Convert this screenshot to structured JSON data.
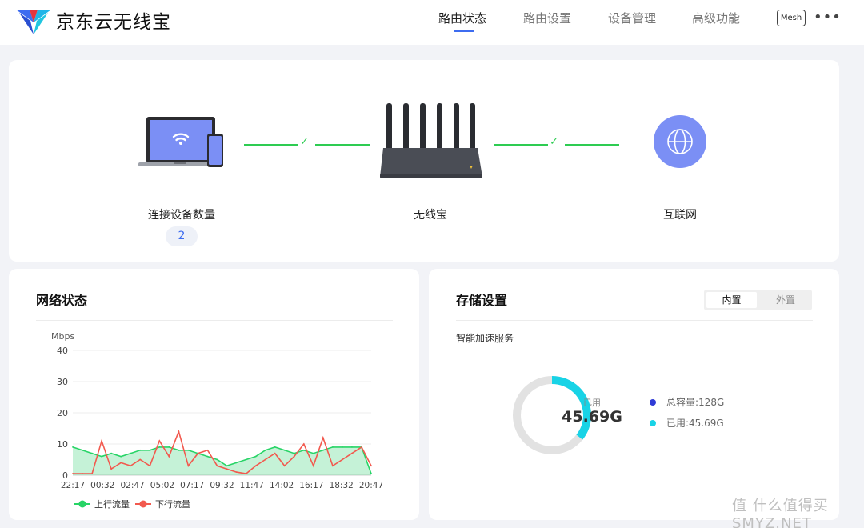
{
  "header": {
    "app_title": "京东云无线宝",
    "nav": [
      {
        "label": "路由状态",
        "active": true
      },
      {
        "label": "路由设置",
        "active": false
      },
      {
        "label": "设备管理",
        "active": false
      },
      {
        "label": "高级功能",
        "active": false
      }
    ],
    "mesh_label": "Mesh",
    "more_icon": "ellipsis-icon"
  },
  "topology": {
    "devices_label": "连接设备数量",
    "devices_count": "2",
    "router_label": "无线宝",
    "internet_label": "互联网",
    "links": [
      "connected",
      "connected"
    ]
  },
  "network": {
    "title": "网络状态",
    "unit": "Mbps",
    "yticks": [
      "40",
      "30",
      "20",
      "10",
      "0"
    ],
    "xticks": [
      "22:17",
      "00:32",
      "02:47",
      "05:02",
      "07:17",
      "09:32",
      "11:47",
      "14:02",
      "16:17",
      "18:32",
      "20:47"
    ],
    "legend": [
      {
        "label": "上行流量",
        "color": "#27d466"
      },
      {
        "label": "下行流量",
        "color": "#f2594e"
      }
    ]
  },
  "storage": {
    "title": "存储设置",
    "tabs": [
      {
        "label": "内置",
        "selected": true
      },
      {
        "label": "外置",
        "selected": false
      }
    ],
    "subtitle": "智能加速服务",
    "donut_caption": "已用",
    "donut_value": "45.69G",
    "legend": [
      {
        "label": "总容量:128G",
        "color": "#2f3bd6"
      },
      {
        "label": "已用:45.69G",
        "color": "#18d3e6"
      }
    ],
    "used_fraction": 0.357
  },
  "colors": {
    "accent": "#3d6cf0",
    "link_ok": "#2ecc52",
    "upload": "#27d466",
    "download": "#f2594e",
    "storage_used": "#18d3e6"
  },
  "watermark": "值 什么值得买 SMYZ.NET",
  "chart_data": {
    "type": "line",
    "title": "",
    "xlabel": "",
    "ylabel": "Mbps",
    "ylim": [
      0,
      40
    ],
    "x": [
      "22:17",
      "23:02",
      "23:47",
      "00:32",
      "01:17",
      "02:02",
      "02:47",
      "03:32",
      "04:17",
      "05:02",
      "05:47",
      "06:32",
      "07:17",
      "08:02",
      "08:47",
      "09:32",
      "10:17",
      "11:02",
      "11:47",
      "12:32",
      "13:17",
      "14:02",
      "14:47",
      "15:32",
      "16:17",
      "17:02",
      "17:47",
      "18:32",
      "19:17",
      "20:02",
      "20:47",
      "21:32"
    ],
    "series": [
      {
        "name": "上行流量",
        "values": [
          9,
          8,
          7,
          6,
          7,
          6,
          7,
          8,
          8,
          9,
          9,
          8,
          8,
          7,
          6,
          5,
          3,
          4,
          5,
          6,
          8,
          9,
          8,
          7,
          8,
          7,
          8,
          9,
          9,
          9,
          9,
          0.5
        ]
      },
      {
        "name": "下行流量",
        "values": [
          0.5,
          0.5,
          0.5,
          11,
          2,
          4,
          3,
          5,
          3,
          11,
          6,
          14,
          3,
          7,
          8,
          3,
          2,
          1,
          0.5,
          3,
          5,
          7,
          3,
          6,
          10,
          3,
          12,
          3,
          5,
          7,
          9,
          3
        ]
      }
    ]
  }
}
